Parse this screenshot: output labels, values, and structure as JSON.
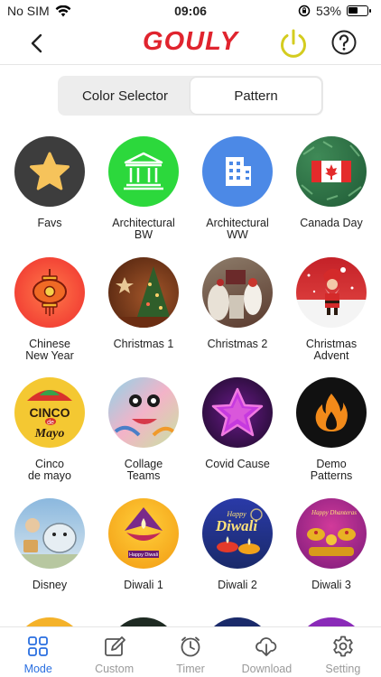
{
  "status_bar": {
    "carrier": "No SIM",
    "time": "09:06",
    "battery": "53%",
    "battery_level": 0.53
  },
  "header": {
    "logo": "GOULY"
  },
  "segments": [
    {
      "label": "Color Selector",
      "active": false
    },
    {
      "label": "Pattern",
      "active": true
    }
  ],
  "patterns": [
    {
      "label": "Favs",
      "icon": "star-icon"
    },
    {
      "label": "Architectural\nBW",
      "icon": "building-columns-icon"
    },
    {
      "label": "Architectural\nWW",
      "icon": "office-building-icon"
    },
    {
      "label": "Canada Day",
      "icon": "canada-flag-icon"
    },
    {
      "label": "Chinese\nNew Year",
      "icon": "lantern-icon"
    },
    {
      "label": "Christmas 1",
      "icon": "christmas-tree-photo"
    },
    {
      "label": "Christmas 2",
      "icon": "christmas-decor-photo"
    },
    {
      "label": "Christmas\nAdvent",
      "icon": "santa-photo"
    },
    {
      "label": "Cinco\nde mayo",
      "icon": "sombrero-icon"
    },
    {
      "label": "Collage\nTeams",
      "icon": "collage-art"
    },
    {
      "label": "Covid Cause",
      "icon": "purple-star-icon"
    },
    {
      "label": "Demo\nPatterns",
      "icon": "flame-icon"
    },
    {
      "label": "Disney",
      "icon": "disney-art"
    },
    {
      "label": "Diwali 1",
      "icon": "diwali-lamp-icon"
    },
    {
      "label": "Diwali 2",
      "icon": "happy-diwali-art"
    },
    {
      "label": "Diwali 3",
      "icon": "happy-dhanteras-art"
    }
  ],
  "diwali_texts": {
    "happy_diwali": "Happy Diwali",
    "happy": "Happy",
    "diwali": "Diwali",
    "happy_dhanteras": "Happy Dhanteras"
  },
  "cinco_text": {
    "line1": "CINCO",
    "line2": "de",
    "line3": "Mayo"
  },
  "tabs": [
    {
      "label": "Mode",
      "icon": "grid-icon",
      "active": true
    },
    {
      "label": "Custom",
      "icon": "edit-icon",
      "active": false
    },
    {
      "label": "Timer",
      "icon": "timer-icon",
      "active": false
    },
    {
      "label": "Download",
      "icon": "cloud-download-icon",
      "active": false
    },
    {
      "label": "Setting",
      "icon": "gear-icon",
      "active": false
    }
  ],
  "colors": {
    "accent": "#2a6fe0",
    "logo": "#e0242e",
    "power": "#d4cc1f"
  }
}
